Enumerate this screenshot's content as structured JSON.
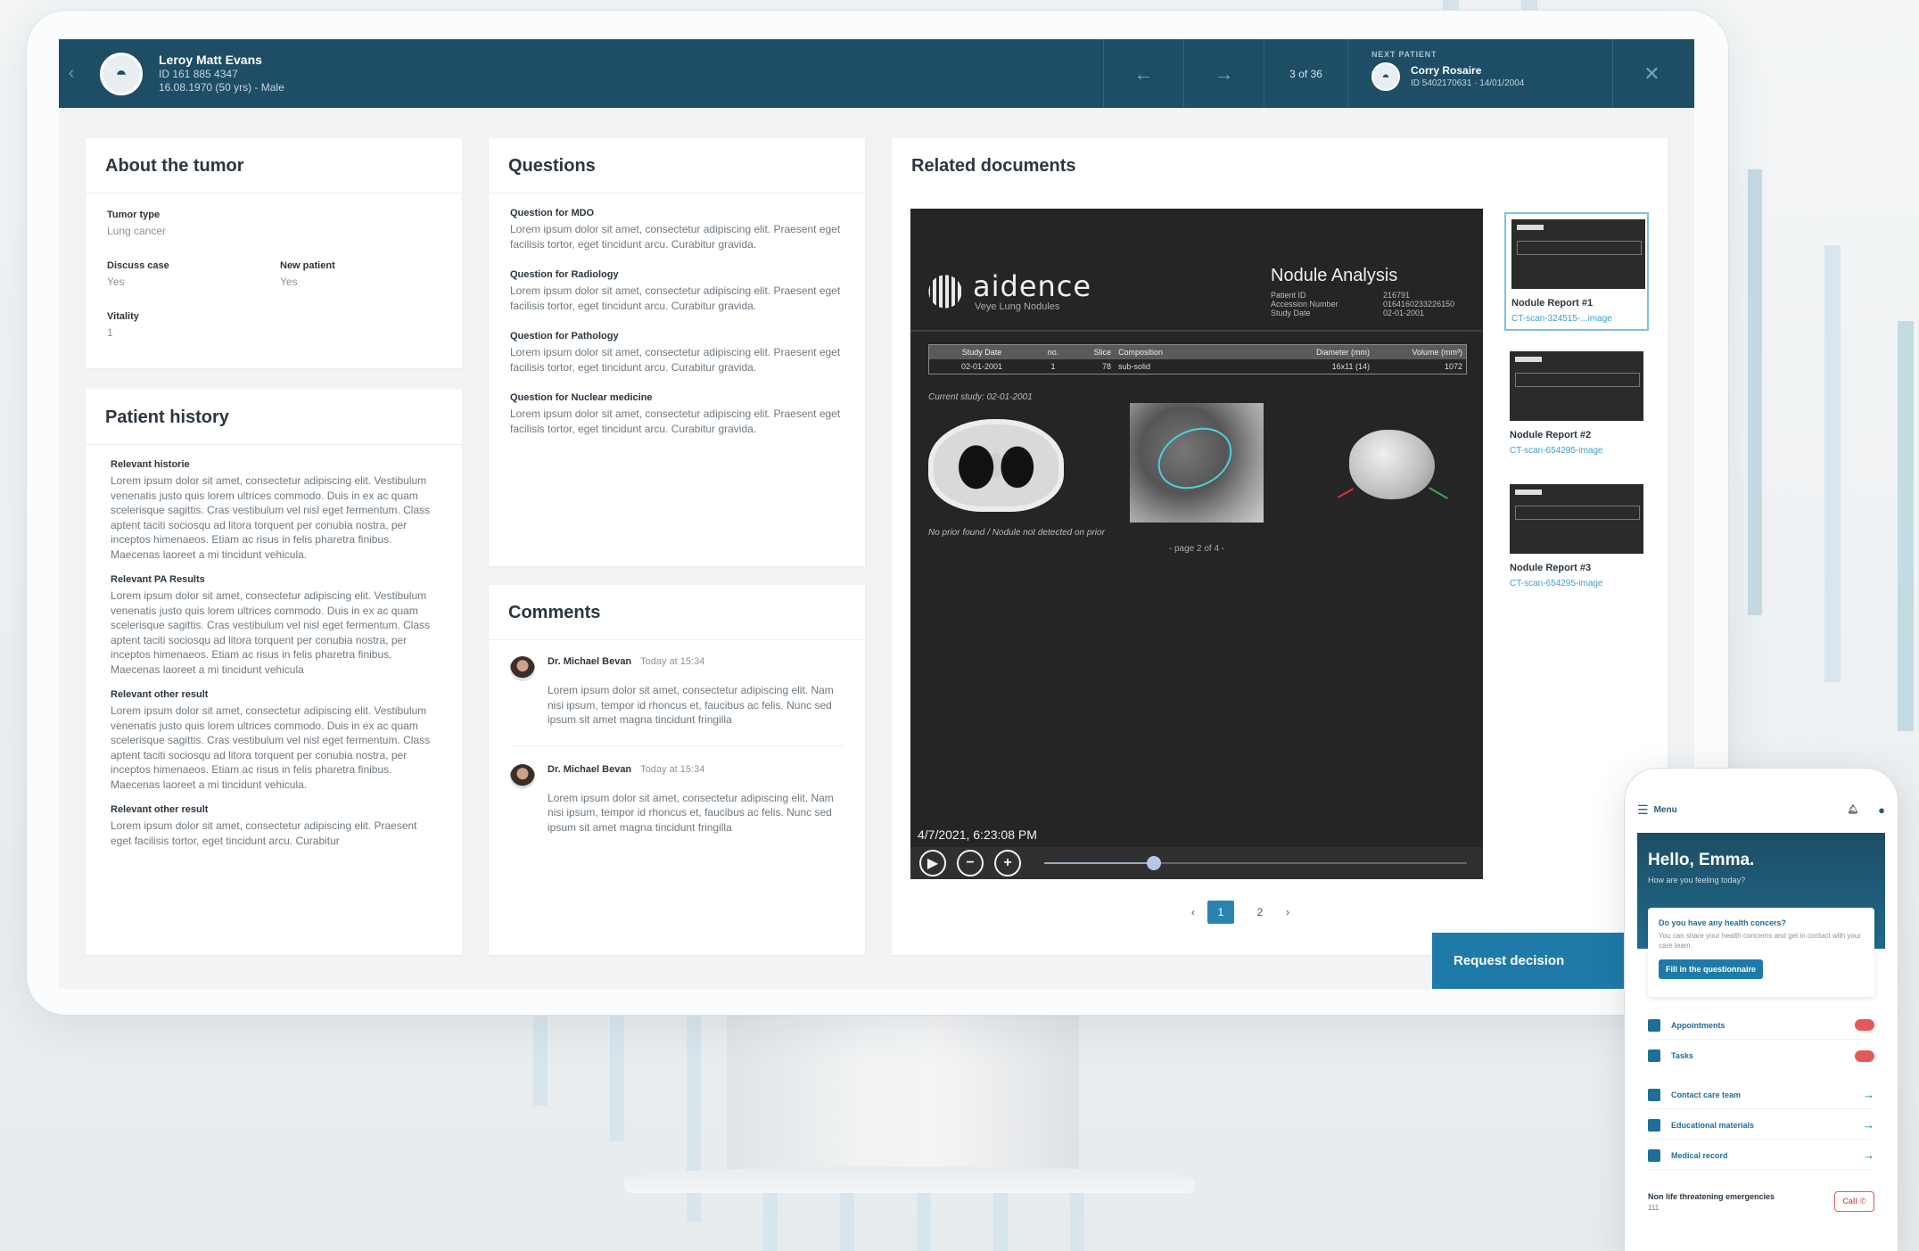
{
  "header": {
    "back_icon": "chevron-left-icon",
    "patient_name": "Leroy Matt Evans",
    "patient_id": "ID 161 885 4347",
    "patient_dob": "16.08.1970 (50 yrs) - Male",
    "prev_icon": "arrow-left-icon",
    "next_icon": "arrow-right-icon",
    "counter": "3 of 36",
    "next_label": "NEXT PATIENT",
    "next_name": "Corry Rosaire",
    "next_details": "ID 5402170631  ·  14/01/2004",
    "close_icon": "close-icon"
  },
  "tumor": {
    "title": "About the tumor",
    "type_label": "Tumor type",
    "type_value": "Lung cancer",
    "discuss_label": "Discuss case",
    "discuss_value": "Yes",
    "new_label": "New patient",
    "new_value": "Yes",
    "vitality_label": "Vitality",
    "vitality_value": "1"
  },
  "history": {
    "title": "Patient history",
    "sections": [
      {
        "heading": "Relevant historie",
        "text": "Lorem ipsum dolor sit amet, consectetur adipiscing elit. Vestibulum venenatis justo quis lorem ultrices commodo. Duis in ex ac quam scelerisque sagittis. Cras vestibulum vel nisl eget fermentum. Class aptent taciti sociosqu ad litora torquent per conubia nostra, per inceptos himenaeos. Etiam ac risus in felis pharetra finibus. Maecenas laoreet a mi tincidunt vehicula."
      },
      {
        "heading": "Relevant PA Results",
        "text": "Lorem ipsum dolor sit amet, consectetur adipiscing elit. Vestibulum venenatis justo quis lorem ultrices commodo. Duis in ex ac quam scelerisque sagittis. Cras vestibulum vel nisl eget fermentum. Class aptent taciti sociosqu ad litora torquent per conubia nostra, per inceptos himenaeos. Etiam ac risus in felis pharetra finibus. Maecenas laoreet a mi tincidunt vehicula"
      },
      {
        "heading": "Relevant other result",
        "text": "Lorem ipsum dolor sit amet, consectetur adipiscing elit. Vestibulum venenatis justo quis lorem ultrices commodo. Duis in ex ac quam scelerisque sagittis. Cras vestibulum vel nisl eget fermentum. Class aptent taciti sociosqu ad litora torquent per conubia nostra, per inceptos himenaeos. Etiam ac risus in felis pharetra finibus. Maecenas laoreet a mi tincidunt vehicula."
      },
      {
        "heading": "Relevant other result",
        "text": "Lorem ipsum dolor sit amet, consectetur adipiscing elit. Praesent eget facilisis tortor, eget tincidunt arcu. Curabitur"
      }
    ]
  },
  "questions": {
    "title": "Questions",
    "items": [
      {
        "heading": "Question for MDO",
        "text": "Lorem ipsum dolor sit amet, consectetur adipiscing elit. Praesent eget facilisis tortor, eget tincidunt arcu. Curabitur gravida."
      },
      {
        "heading": "Question for Radiology",
        "text": "Lorem ipsum dolor sit amet, consectetur adipiscing elit. Praesent eget facilisis tortor, eget tincidunt arcu. Curabitur gravida."
      },
      {
        "heading": "Question for Pathology",
        "text": "Lorem ipsum dolor sit amet, consectetur adipiscing elit. Praesent eget facilisis tortor, eget tincidunt arcu. Curabitur gravida."
      },
      {
        "heading": "Question for Nuclear medicine",
        "text": "Lorem ipsum dolor sit amet, consectetur adipiscing elit. Praesent eget facilisis tortor, eget tincidunt arcu. Curabitur gravida."
      }
    ]
  },
  "comments": {
    "title": "Comments",
    "items": [
      {
        "author": "Dr. Michael Bevan",
        "time": "Today at 15:34",
        "text": "Lorem ipsum dolor sit amet, consectetur adipiscing elit. Nam nisi ipsum, tempor id rhoncus et, faucibus ac felis. Nunc sed ipsum sit amet magna tincidunt fringilla"
      },
      {
        "author": "Dr. Michael Bevan",
        "time": "Today at 15:34",
        "text": "Lorem ipsum dolor sit amet, consectetur adipiscing elit. Nam nisi ipsum, tempor id rhoncus et, faucibus ac felis. Nunc sed ipsum sit amet magna tincidunt fringilla"
      }
    ]
  },
  "documents": {
    "title": "Related documents",
    "report": {
      "brand": "aidence",
      "brand_sub": "Veye Lung Nodules",
      "title": "Nodule Analysis",
      "meta_labels": [
        "Patient ID",
        "Accession Number",
        "Study Date"
      ],
      "meta_values": [
        "216791",
        "0164160233226150",
        "02-01-2001"
      ],
      "table_headers": [
        "Study Date",
        "no.",
        "Slice",
        "Composition",
        "Diameter (mm)",
        "Volume (mm³)"
      ],
      "table_row": [
        "02-01-2001",
        "1",
        "78",
        "sub-solid",
        "16x11 (14)",
        "1072"
      ],
      "current_study": "Current study: 02-01-2001",
      "no_prior": "No prior found / Nodule not detected on prior",
      "page": "- page 2 of 4 -"
    },
    "timestamp": "4/7/2021, 6:23:08 PM",
    "playback_position": 0.26,
    "controls": {
      "play": "play-icon",
      "zoom_out": "zoom-out-icon",
      "zoom_in": "zoom-in-icon"
    },
    "pager": {
      "prev": "‹",
      "pages": [
        "1",
        "2"
      ],
      "active": "1",
      "next": "›"
    },
    "thumbnails": [
      {
        "title": "Nodule Report #1",
        "link": "CT-scan-324515-...image",
        "selected": true
      },
      {
        "title": "Nodule Report #2",
        "link": "CT-scan-654295-image",
        "selected": false
      },
      {
        "title": "Nodule Report #3",
        "link": "CT-scan-654295-image",
        "selected": false
      }
    ]
  },
  "request_button": "Request decision",
  "phone": {
    "menu": "Menu",
    "hello": "Hello, Emma.",
    "sub": "How are you feeling today?",
    "card_title": "Do you have any health concers?",
    "card_text": "You can share your health concerns and get in contact with your care team.",
    "card_button": "Fill in the questionnaire",
    "items": [
      {
        "label": "Appointments",
        "kind": "badge"
      },
      {
        "label": "Tasks",
        "kind": "badge"
      },
      {
        "label": "Contact care team",
        "kind": "arrow"
      },
      {
        "label": "Educational materials",
        "kind": "arrow"
      },
      {
        "label": "Medical record",
        "kind": "arrow"
      }
    ],
    "emergency_title": "Non life threatening emergencies",
    "emergency_number": "111",
    "call": "Call"
  },
  "colors": {
    "header": "#1e4d66",
    "accent": "#1e7aa8",
    "link": "#3d9fce",
    "badge": "#e45a5a"
  }
}
